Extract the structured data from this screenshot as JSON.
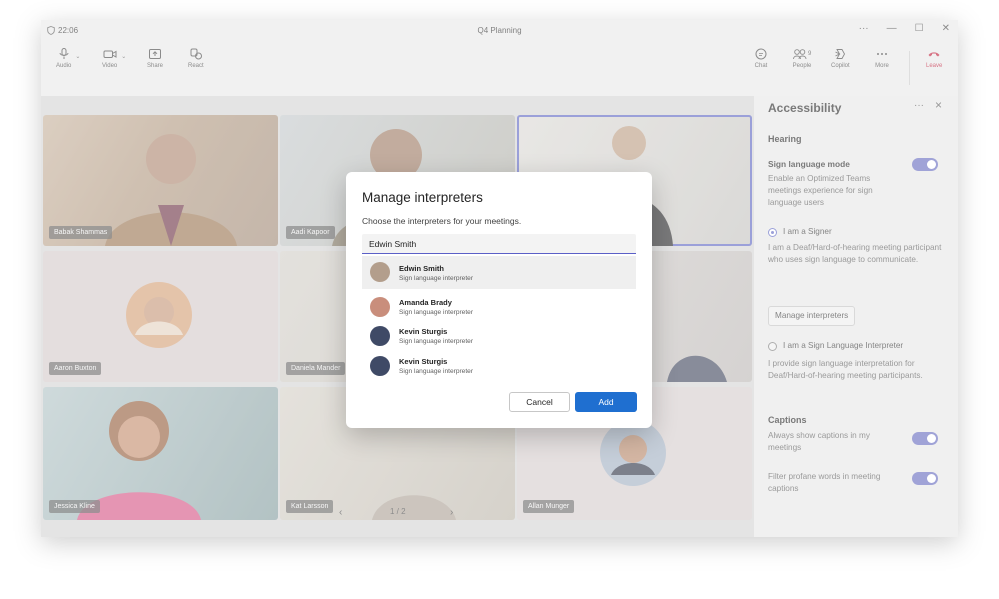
{
  "window": {
    "clock": "22:06",
    "title": "Q4 Planning"
  },
  "toolbar": {
    "audio": "Audio",
    "video": "Video",
    "share": "Share",
    "react": "React",
    "chat": "Chat",
    "people": "People",
    "people_count": "9",
    "copilot": "Copilot",
    "more": "More",
    "leave": "Leave"
  },
  "participants": [
    "Babak Shammas",
    "Aadi Kapoor",
    "Aaron Buxton",
    "Daniela Mander",
    "Jessica Kline",
    "Kat Larsson",
    "Allan Munger"
  ],
  "pager": {
    "label": "1 / 2"
  },
  "panel": {
    "title": "Accessibility",
    "hearing_heading": "Hearing",
    "sign_mode_label": "Sign language mode",
    "sign_mode_desc": "Enable an Optimized Teams meetings experience for sign language users",
    "signer_label": "I am a Signer",
    "signer_desc": "I am a Deaf/Hard-of-hearing meeting participant who uses sign language to communicate.",
    "manage_button": "Manage interpreters",
    "interpreter_label": "I am a Sign Language Interpreter",
    "interpreter_desc": "I provide sign language interpretation for Deaf/Hard-of-hearing meeting participants.",
    "captions_heading": "Captions",
    "always_captions": "Always show captions in my meetings",
    "filter_profane": "Filter profane words in meeting captions"
  },
  "dialog": {
    "title": "Manage interpreters",
    "subtitle": "Choose the interpreters for your meetings.",
    "search_value": "Edwin Smith",
    "results": [
      {
        "name": "Edwin Smith",
        "role": "Sign language interpreter"
      },
      {
        "name": "Amanda Brady",
        "role": "Sign language interpreter"
      },
      {
        "name": "Kevin Sturgis",
        "role": "Sign language interpreter"
      },
      {
        "name": "Kevin Sturgis",
        "role": "Sign language interpreter"
      }
    ],
    "cancel": "Cancel",
    "add": "Add"
  },
  "colors": {
    "accent": "#6c74c8",
    "primary_button": "#1f6fd0",
    "leave": "#c4314b"
  }
}
